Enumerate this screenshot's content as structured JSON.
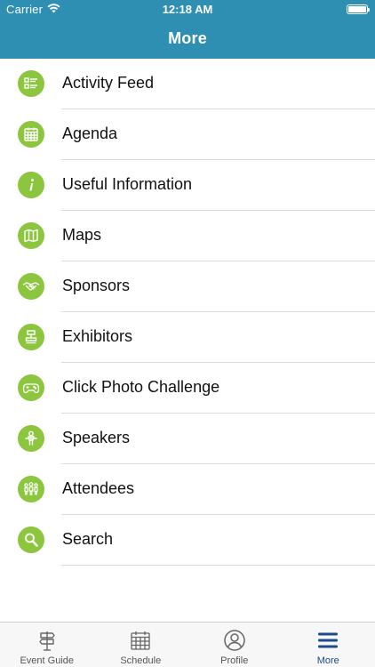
{
  "status_bar": {
    "carrier": "Carrier",
    "time": "12:18 AM"
  },
  "header": {
    "title": "More"
  },
  "menu": {
    "items": [
      {
        "label": "Activity Feed",
        "icon": "activity-feed-icon"
      },
      {
        "label": "Agenda",
        "icon": "calendar-icon"
      },
      {
        "label": "Useful Information",
        "icon": "info-icon"
      },
      {
        "label": "Maps",
        "icon": "map-icon"
      },
      {
        "label": "Sponsors",
        "icon": "handshake-icon"
      },
      {
        "label": "Exhibitors",
        "icon": "booth-icon"
      },
      {
        "label": "Click Photo Challenge",
        "icon": "gamepad-icon"
      },
      {
        "label": "Speakers",
        "icon": "speaker-icon"
      },
      {
        "label": "Attendees",
        "icon": "people-icon"
      },
      {
        "label": "Search",
        "icon": "search-icon"
      }
    ]
  },
  "tabbar": {
    "tabs": [
      {
        "label": "Event Guide",
        "icon": "signpost-icon"
      },
      {
        "label": "Schedule",
        "icon": "calendar-icon"
      },
      {
        "label": "Profile",
        "icon": "profile-icon"
      },
      {
        "label": "More",
        "icon": "menu-icon",
        "active": true
      }
    ]
  },
  "colors": {
    "header": "#2f8fb3",
    "icon_green": "#8cc63f",
    "tab_active": "#1c4a8a",
    "tab_inactive": "#555555"
  }
}
